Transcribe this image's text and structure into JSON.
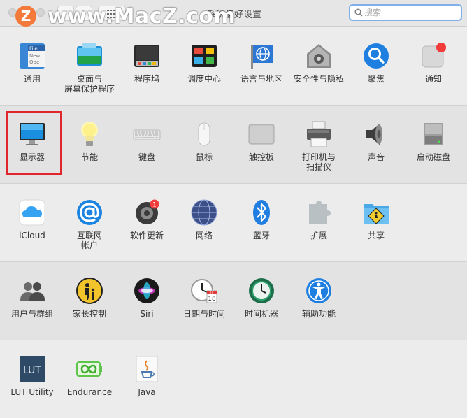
{
  "window": {
    "title": "系统偏好设置"
  },
  "search": {
    "placeholder": "搜索"
  },
  "watermark": {
    "logo": "Z",
    "text": "www.MacZ.com"
  },
  "highlight_color": "#e0262b",
  "sections": [
    {
      "items": [
        {
          "label": "通用",
          "icon": "general-icon"
        },
        {
          "label": "桌面与\n屏幕保护程序",
          "icon": "desktop-screensaver-icon"
        },
        {
          "label": "程序坞",
          "icon": "dock-icon"
        },
        {
          "label": "调度中心",
          "icon": "mission-control-icon"
        },
        {
          "label": "语言与地区",
          "icon": "language-region-icon"
        },
        {
          "label": "安全性与隐私",
          "icon": "security-privacy-icon"
        },
        {
          "label": "聚焦",
          "icon": "spotlight-icon"
        },
        {
          "label": "通知",
          "icon": "notifications-icon"
        }
      ]
    },
    {
      "items": [
        {
          "label": "显示器",
          "icon": "displays-icon",
          "selected": true
        },
        {
          "label": "节能",
          "icon": "energy-saver-icon"
        },
        {
          "label": "键盘",
          "icon": "keyboard-icon"
        },
        {
          "label": "鼠标",
          "icon": "mouse-icon"
        },
        {
          "label": "触控板",
          "icon": "trackpad-icon"
        },
        {
          "label": "打印机与\n扫描仪",
          "icon": "printers-scanners-icon"
        },
        {
          "label": "声音",
          "icon": "sound-icon"
        },
        {
          "label": "启动磁盘",
          "icon": "startup-disk-icon"
        }
      ]
    },
    {
      "items": [
        {
          "label": "iCloud",
          "icon": "icloud-icon"
        },
        {
          "label": "互联网\n帐户",
          "icon": "internet-accounts-icon"
        },
        {
          "label": "软件更新",
          "icon": "software-update-icon",
          "badge": "1"
        },
        {
          "label": "网络",
          "icon": "network-icon"
        },
        {
          "label": "蓝牙",
          "icon": "bluetooth-icon"
        },
        {
          "label": "扩展",
          "icon": "extensions-icon"
        },
        {
          "label": "共享",
          "icon": "sharing-icon"
        }
      ]
    },
    {
      "items": [
        {
          "label": "用户与群组",
          "icon": "users-groups-icon"
        },
        {
          "label": "家长控制",
          "icon": "parental-controls-icon"
        },
        {
          "label": "Siri",
          "icon": "siri-icon"
        },
        {
          "label": "日期与时间",
          "icon": "date-time-icon",
          "calendar_text": "JUL",
          "calendar_day": "18"
        },
        {
          "label": "时间机器",
          "icon": "time-machine-icon"
        },
        {
          "label": "辅助功能",
          "icon": "accessibility-icon"
        }
      ]
    },
    {
      "items": [
        {
          "label": "LUT Utility",
          "icon": "lut-utility-icon",
          "icon_text": "LUT"
        },
        {
          "label": "Endurance",
          "icon": "endurance-icon"
        },
        {
          "label": "Java",
          "icon": "java-icon"
        }
      ]
    }
  ],
  "general_icon_text": [
    "File",
    "New",
    "Ope"
  ]
}
